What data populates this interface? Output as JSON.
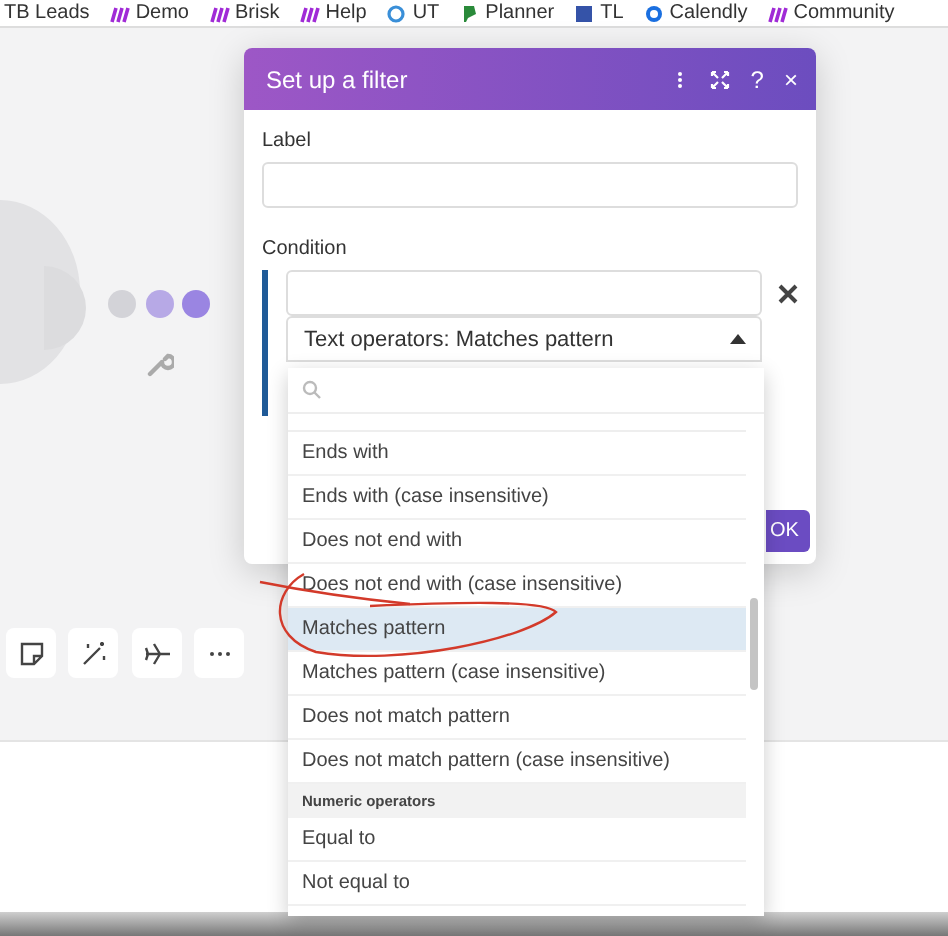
{
  "bookmarks": [
    {
      "label": "TB Leads",
      "kind": "plain"
    },
    {
      "label": "Demo",
      "kind": "make"
    },
    {
      "label": "Brisk",
      "kind": "make"
    },
    {
      "label": "Help",
      "kind": "make"
    },
    {
      "label": "UT",
      "kind": "ring"
    },
    {
      "label": "Planner",
      "kind": "planner"
    },
    {
      "label": "TL",
      "kind": "square"
    },
    {
      "label": "Calendly",
      "kind": "calendly"
    },
    {
      "label": "Community",
      "kind": "make"
    }
  ],
  "dialog": {
    "title": "Set up a filter",
    "help": "?",
    "close": "×",
    "label_field": {
      "label": "Label"
    },
    "condition": {
      "label": "Condition",
      "operator": "Text operators: Matches pattern",
      "expanded": true
    },
    "ok_button": "OK"
  },
  "dropdown": {
    "items": [
      {
        "kind": "option",
        "label": "Ends with",
        "selected": false
      },
      {
        "kind": "option",
        "label": "Ends with (case insensitive)",
        "selected": false
      },
      {
        "kind": "option",
        "label": "Does not end with",
        "selected": false
      },
      {
        "kind": "option",
        "label": "Does not end with (case insensitive)",
        "selected": false
      },
      {
        "kind": "option",
        "label": "Matches pattern",
        "selected": true
      },
      {
        "kind": "option",
        "label": "Matches pattern (case insensitive)",
        "selected": false
      },
      {
        "kind": "option",
        "label": "Does not match pattern",
        "selected": false
      },
      {
        "kind": "option",
        "label": "Does not match pattern (case insensitive)",
        "selected": false
      },
      {
        "kind": "group",
        "label": "Numeric operators"
      },
      {
        "kind": "option",
        "label": "Equal to",
        "selected": false
      },
      {
        "kind": "option",
        "label": "Not equal to",
        "selected": false
      }
    ]
  }
}
